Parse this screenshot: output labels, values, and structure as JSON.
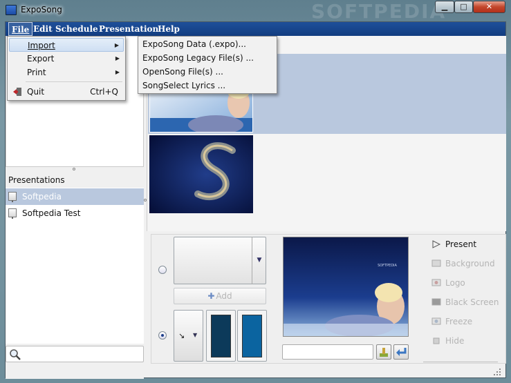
{
  "window": {
    "title": "ExpoSong",
    "watermark": "SOFTPEDIA"
  },
  "menubar": [
    "File",
    "Edit",
    "Schedule",
    "Presentation",
    "Help"
  ],
  "file_menu": {
    "items": [
      {
        "label": "Import",
        "has_submenu": true
      },
      {
        "label": "Export",
        "has_submenu": true
      },
      {
        "label": "Print",
        "has_submenu": true
      }
    ],
    "quit": {
      "label": "Quit",
      "shortcut": "Ctrl+Q"
    }
  },
  "import_submenu": [
    "ExpoSong Data (.expo)...",
    "ExpoSong Legacy File(s) ...",
    "OpenSong File(s) ...",
    "SongSelect Lyrics ..."
  ],
  "presentations": {
    "header": "Presentations",
    "items": [
      {
        "label": "Softpedia",
        "selected": true
      },
      {
        "label": "Softpedia Test",
        "selected": false
      }
    ]
  },
  "search": {
    "value": ""
  },
  "add_button": {
    "label": "Add"
  },
  "preview": {
    "overlay_text": "SOFTPEDIA"
  },
  "controls": [
    {
      "label": "Present",
      "enabled": true,
      "icon": "play-icon"
    },
    {
      "label": "Background",
      "enabled": false,
      "icon": "background-icon"
    },
    {
      "label": "Logo",
      "enabled": false,
      "icon": "logo-icon"
    },
    {
      "label": "Black Screen",
      "enabled": false,
      "icon": "black-screen-icon"
    },
    {
      "label": "Freeze",
      "enabled": false,
      "icon": "freeze-icon"
    },
    {
      "label": "Hide",
      "enabled": false,
      "icon": "hide-icon"
    }
  ],
  "colors": {
    "menubar": "#1a4a92",
    "selection": "#b9c8de",
    "swatch_dark": "#0c3a5a",
    "swatch_light": "#0b64a0"
  }
}
